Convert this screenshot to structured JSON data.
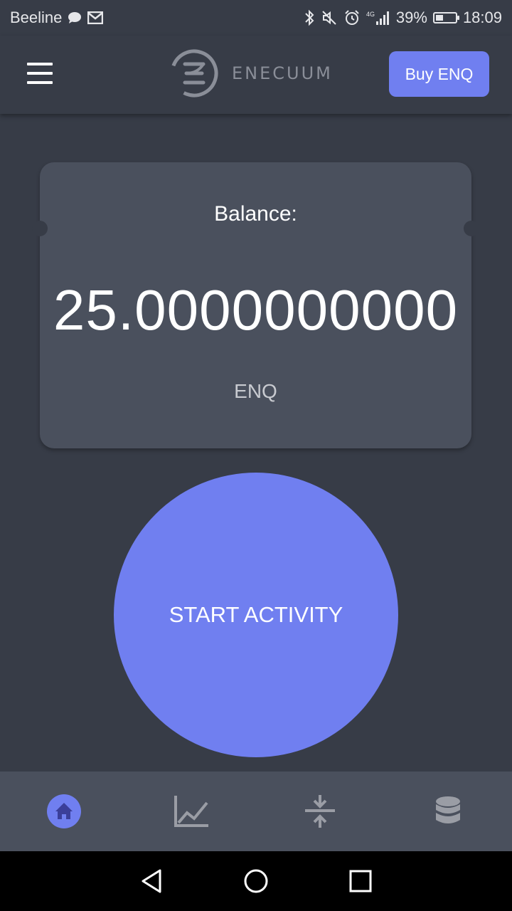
{
  "status_bar": {
    "carrier": "Beeline",
    "network": "4G",
    "battery_percent": "39%",
    "battery_level": 0.39,
    "time": "18:09",
    "icons_left": [
      "chat-bubble-icon",
      "mail-icon"
    ],
    "icons_right": [
      "bluetooth-icon",
      "mute-icon",
      "alarm-icon",
      "signal-icon",
      "battery-icon"
    ]
  },
  "header": {
    "logo_text": "ENECUUM",
    "buy_label": "Buy ENQ",
    "menu_icon": "hamburger-menu-icon"
  },
  "card": {
    "label": "Balance:",
    "value": "25.0000000000",
    "unit": "ENQ"
  },
  "start_button": {
    "label": "START ACTIVITY"
  },
  "bottom_nav": {
    "items": [
      {
        "icon": "home-icon",
        "active": true
      },
      {
        "icon": "chart-icon",
        "active": false
      },
      {
        "icon": "transfer-icon",
        "active": false
      },
      {
        "icon": "database-icon",
        "active": false
      }
    ]
  },
  "colors": {
    "background": "#373c47",
    "card": "#4a505d",
    "accent": "#707ff0",
    "inactive_icon": "#9a9da5"
  }
}
